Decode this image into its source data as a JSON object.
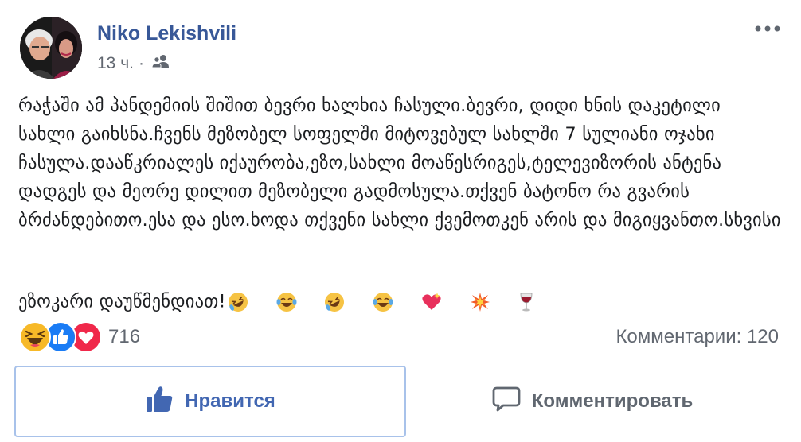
{
  "post": {
    "author": "Niko Lekishvili",
    "time": "13 ч.",
    "audience_icon": "friends-icon",
    "text": "რაჭაში ამ პანდემიის შიშით ბევრი ხალხია ჩასული.ბევრი, დიდი ხნის დაკეტილი სახლი გაიხსნა.ჩვენს მეზობელ სოფელში მიტოვებულ სახლში 7 სულიანი ოჯახი ჩასულა.დააწკრიალეს იქაურობა,ეზო,სახლი მოაწესრიგეს,ტელევიზორის ანტენა დადგეს და მეორე დილით მეზობელი გადმოსულა.თქვენ ბატონო რა გვარის ბრძანდებითო.ესა და ესო.ხოდა თქვენი სახლი ქვემოთკენ არის და მიგიყვანთო.სხვისი ეზოკარი დაუწმენდიათ!",
    "emojis": [
      "rofl-icon",
      "joy-icon",
      "rofl-icon",
      "joy-icon",
      "sparkling-heart-icon",
      "collision-icon",
      "wine-glass-icon"
    ]
  },
  "reactions": {
    "icons": [
      "haha-reaction-icon",
      "like-reaction-icon",
      "love-reaction-icon"
    ],
    "count": "716"
  },
  "comments": {
    "count_label": "Комментарии: 120"
  },
  "actions": {
    "like_label": "Нравится",
    "comment_label": "Комментировать"
  },
  "colors": {
    "author": "#385898",
    "like_blue": "#4267b2",
    "meta_gray": "#616770",
    "focus_border": "#a8c2ea"
  }
}
